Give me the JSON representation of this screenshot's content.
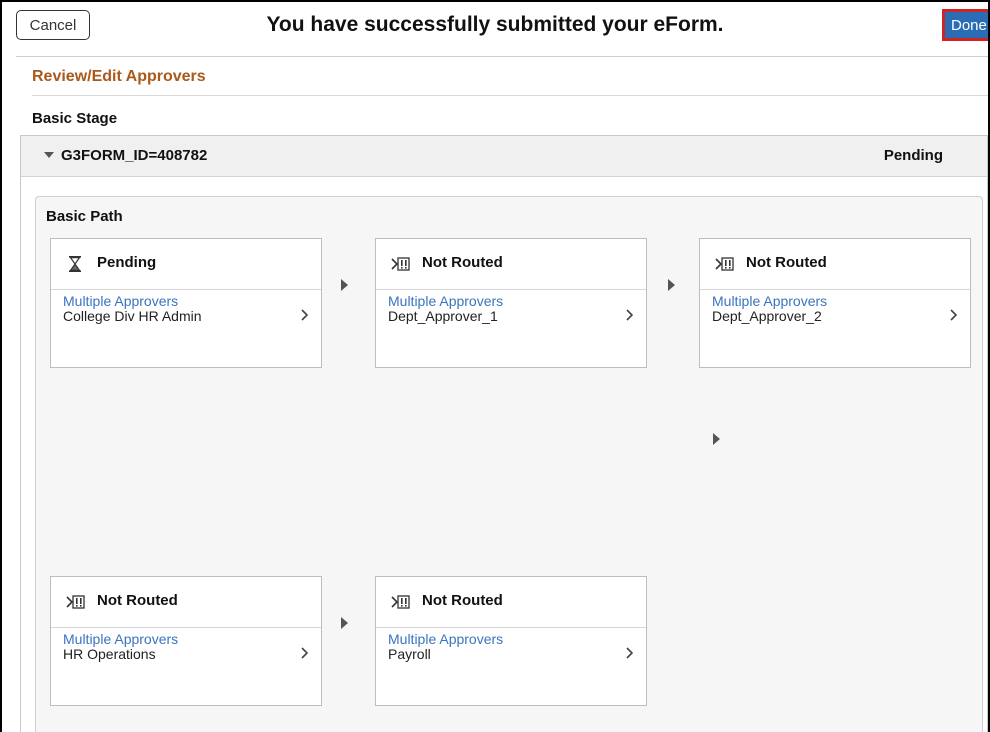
{
  "header": {
    "cancel_label": "Cancel",
    "title": "You have successfully submitted your eForm.",
    "done_label": "Done"
  },
  "section": {
    "title": "Review/Edit Approvers",
    "stage_label": "Basic Stage"
  },
  "group": {
    "id_label": "G3FORM_ID=408782",
    "status": "Pending",
    "path_title": "Basic Path"
  },
  "steps": [
    {
      "status": "Pending",
      "icon": "hourglass-icon",
      "link": "Multiple Approvers",
      "approver": "College Div HR Admin"
    },
    {
      "status": "Not Routed",
      "icon": "not-routed-icon",
      "link": "Multiple Approvers",
      "approver": "Dept_Approver_1"
    },
    {
      "status": "Not Routed",
      "icon": "not-routed-icon",
      "link": "Multiple Approvers",
      "approver": "Dept_Approver_2"
    },
    {
      "status": "Not Routed",
      "icon": "not-routed-icon",
      "link": "Multiple Approvers",
      "approver": "HR Operations"
    },
    {
      "status": "Not Routed",
      "icon": "not-routed-icon",
      "link": "Multiple Approvers",
      "approver": "Payroll"
    }
  ],
  "colors": {
    "section_title": "#a8591b",
    "link": "#3a74bf",
    "done_bg": "#2b6db4",
    "done_highlight": "#d02424"
  }
}
